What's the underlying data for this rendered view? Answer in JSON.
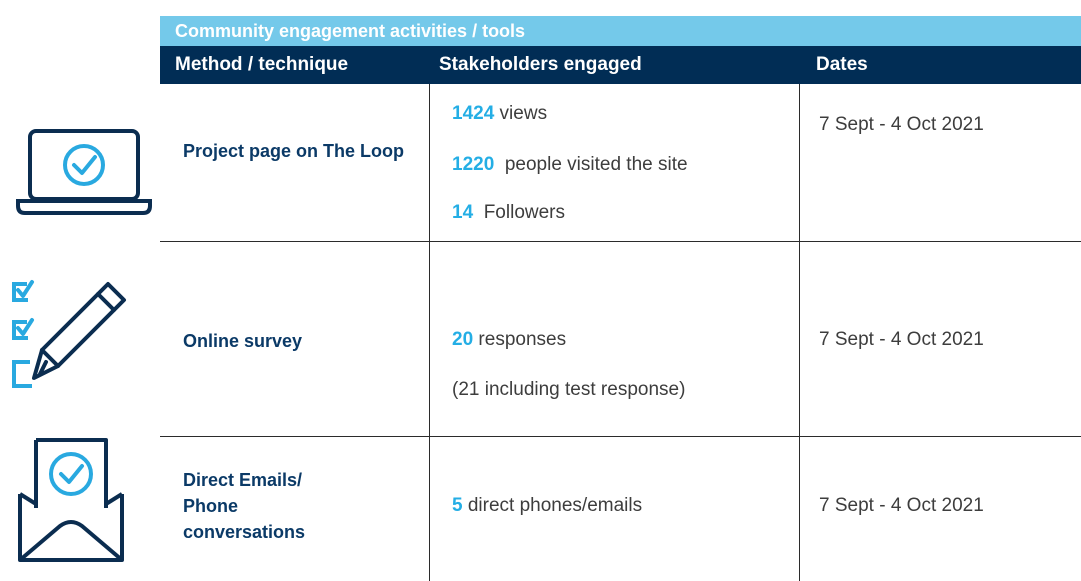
{
  "title": "Community engagement activities / tools",
  "headers": {
    "method": "Method / technique",
    "stakeholders": "Stakeholders engaged",
    "dates": "Dates"
  },
  "rows": [
    {
      "icon": "laptop-check-icon",
      "method": "Project page on The Loop",
      "stakeholders": [
        {
          "number": "1424",
          "text": " views"
        },
        {
          "number": "1220",
          "text": "  people visited the site"
        },
        {
          "number": "14",
          "text": "  Followers"
        }
      ],
      "dates": "7 Sept - 4 Oct 2021"
    },
    {
      "icon": "checklist-pencil-icon",
      "method": "Online survey",
      "stakeholders": [
        {
          "number": "20",
          "text": " responses"
        },
        {
          "number": "",
          "text": "(21 including test response)"
        }
      ],
      "dates": "7 Sept - 4 Oct 2021"
    },
    {
      "icon": "envelope-check-icon",
      "method": "Direct Emails/ Phone conversations",
      "stakeholders": [
        {
          "number": "5",
          "text": " direct phones/emails"
        }
      ],
      "dates": "7 Sept - 4 Oct 2021"
    }
  ],
  "colors": {
    "title_bg": "#74c9ea",
    "header_bg": "#012d55",
    "accent_number": "#24aee5",
    "method_text": "#0b3a67",
    "icon_dark": "#0b2d50",
    "icon_light": "#29a9e0"
  }
}
